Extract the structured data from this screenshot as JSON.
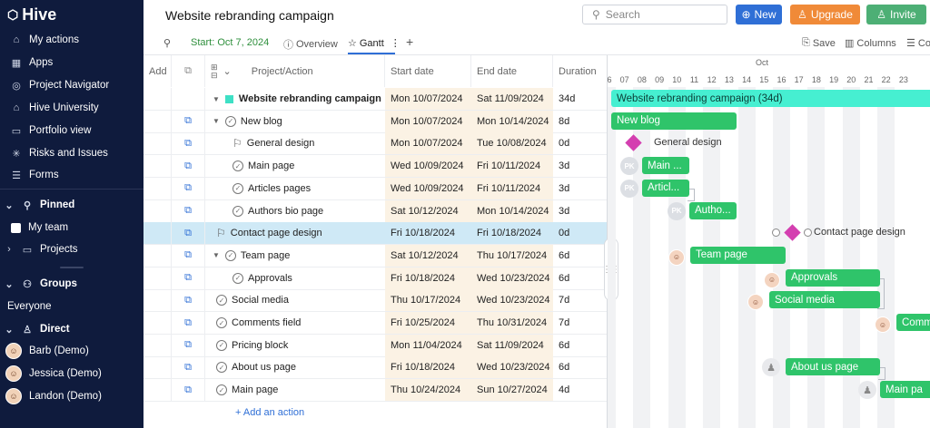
{
  "app": {
    "name": "Hive"
  },
  "sidebar": {
    "items": [
      {
        "label": "My actions",
        "icon": "home-icon"
      },
      {
        "label": "Apps",
        "icon": "apps-grid-icon"
      },
      {
        "label": "Project Navigator",
        "icon": "compass-icon"
      },
      {
        "label": "Hive University",
        "icon": "graduation-cap-icon"
      },
      {
        "label": "Portfolio view",
        "icon": "portfolio-icon"
      },
      {
        "label": "Risks and Issues",
        "icon": "risk-icon"
      },
      {
        "label": "Forms",
        "icon": "forms-icon"
      }
    ],
    "pinned_label": "Pinned",
    "pinned_items": [
      {
        "label": "My team"
      },
      {
        "label": "Projects"
      }
    ],
    "groups_label": "Groups",
    "groups_items": [
      {
        "label": "Everyone"
      }
    ],
    "direct_label": "Direct",
    "direct_items": [
      {
        "label": "Barb (Demo)"
      },
      {
        "label": "Jessica (Demo)"
      },
      {
        "label": "Landon (Demo)"
      }
    ]
  },
  "header": {
    "title": "Website rebranding campaign",
    "search_placeholder": "Search",
    "new_label": "New",
    "upgrade_label": "Upgrade",
    "invite_label": "Invite"
  },
  "tabs": {
    "start": "Start: Oct 7, 2024",
    "overview": "Overview",
    "gantt": "Gantt",
    "save": "Save",
    "columns": "Columns",
    "more": "Co"
  },
  "grid": {
    "headers": {
      "add": "Add",
      "name": "Project/Action",
      "start": "Start date",
      "end": "End date",
      "duration": "Duration"
    },
    "rows": [
      {
        "name": "Website rebranding campaign",
        "start": "Mon 10/07/2024",
        "end": "Sat 11/09/2024",
        "duration": "34d"
      },
      {
        "name": "New blog",
        "start": "Mon 10/07/2024",
        "end": "Mon 10/14/2024",
        "duration": "8d"
      },
      {
        "name": "General design",
        "start": "Mon 10/07/2024",
        "end": "Tue 10/08/2024",
        "duration": "0d"
      },
      {
        "name": "Main page",
        "start": "Wed 10/09/2024",
        "end": "Fri 10/11/2024",
        "duration": "3d"
      },
      {
        "name": "Articles pages",
        "start": "Wed 10/09/2024",
        "end": "Fri 10/11/2024",
        "duration": "3d"
      },
      {
        "name": "Authors bio page",
        "start": "Sat 10/12/2024",
        "end": "Mon 10/14/2024",
        "duration": "3d"
      },
      {
        "name": "Contact page design",
        "start": "Fri 10/18/2024",
        "end": "Fri 10/18/2024",
        "duration": "0d"
      },
      {
        "name": "Team page",
        "start": "Sat 10/12/2024",
        "end": "Thu 10/17/2024",
        "duration": "6d"
      },
      {
        "name": "Approvals",
        "start": "Fri 10/18/2024",
        "end": "Wed 10/23/2024",
        "duration": "6d"
      },
      {
        "name": "Social media",
        "start": "Thu 10/17/2024",
        "end": "Wed 10/23/2024",
        "duration": "7d"
      },
      {
        "name": "Comments field",
        "start": "Fri 10/25/2024",
        "end": "Thu 10/31/2024",
        "duration": "7d"
      },
      {
        "name": "Pricing block",
        "start": "Mon 11/04/2024",
        "end": "Sat 11/09/2024",
        "duration": "6d"
      },
      {
        "name": "About us page",
        "start": "Fri 10/18/2024",
        "end": "Wed 10/23/2024",
        "duration": "6d"
      },
      {
        "name": "Main page",
        "start": "Thu 10/24/2024",
        "end": "Sun 10/27/2024",
        "duration": "4d"
      }
    ],
    "add_action": "+ Add an action"
  },
  "gantt": {
    "month": "Oct",
    "days": [
      "06",
      "07",
      "08",
      "09",
      "10",
      "11",
      "12",
      "13",
      "14",
      "15",
      "16",
      "17",
      "18",
      "19",
      "20",
      "21",
      "22",
      "23"
    ],
    "bars": {
      "project": "Website rebranding campaign (34d)",
      "new_blog": "New blog",
      "general_design": "General design",
      "main_page": "Main ...",
      "articles": "Articl...",
      "authors": "Autho...",
      "contact": "Contact page design",
      "team": "Team page",
      "approvals": "Approvals",
      "social": "Social media",
      "comments": "Comm",
      "about": "About us page",
      "main_page2": "Main pa"
    },
    "pk_initials": "PK",
    "colors": {
      "task": "#2fc46a",
      "project": "#46efd1",
      "milestone": "#d43fb0"
    }
  }
}
